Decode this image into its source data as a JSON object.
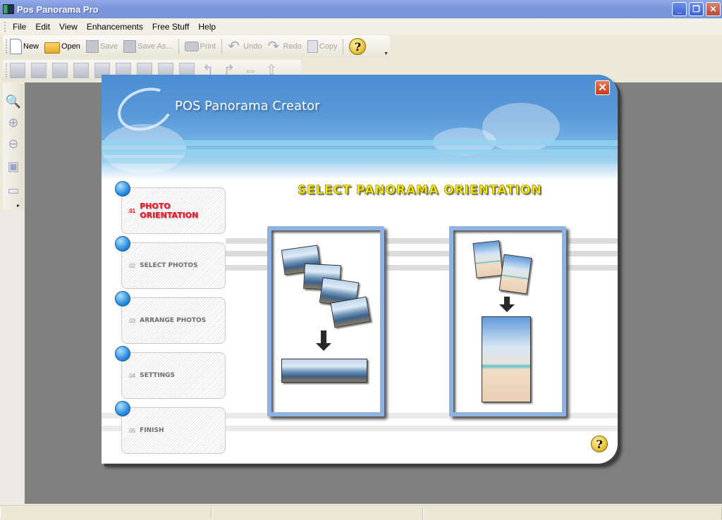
{
  "window": {
    "title": "Pos Panorama Pro",
    "controls": [
      "minimize",
      "restore",
      "close"
    ]
  },
  "menu": [
    "File",
    "Edit",
    "View",
    "Enhancements",
    "Free Stuff",
    "Help"
  ],
  "toolbar": [
    {
      "label": "New",
      "icon": "new-document-icon",
      "enabled": true
    },
    {
      "label": "Open",
      "icon": "folder-open-icon",
      "enabled": true
    },
    {
      "label": "Save",
      "icon": "save-icon",
      "enabled": false
    },
    {
      "label": "Save As...",
      "icon": "save-as-icon",
      "enabled": false
    },
    {
      "label": "Print",
      "icon": "printer-icon",
      "enabled": false
    },
    {
      "label": "Undo",
      "icon": "undo-icon",
      "enabled": false
    },
    {
      "label": "Redo",
      "icon": "redo-icon",
      "enabled": false
    },
    {
      "label": "Copy",
      "icon": "copy-icon",
      "enabled": false
    }
  ],
  "toolbar_help_icon": "?",
  "dialog": {
    "title": "POS Panorama Creator",
    "close_glyph": "✕",
    "heading": "SELECT PANORAMA ORIENTATION",
    "steps": [
      {
        "num": ".01",
        "label": "PHOTO ORIENTATION",
        "active": true
      },
      {
        "num": ".02",
        "label": "SELECT PHOTOS",
        "active": false
      },
      {
        "num": ".03",
        "label": "ARRANGE PHOTOS",
        "active": false
      },
      {
        "num": ".04",
        "label": "SETTINGS",
        "active": false
      },
      {
        "num": ".05",
        "label": "FINISH",
        "active": false
      }
    ],
    "options": [
      {
        "name": "horizontal",
        "description": "Horizontal panorama"
      },
      {
        "name": "vertical",
        "description": "Vertical panorama"
      }
    ],
    "help_glyph": "?"
  },
  "colors": {
    "titlebar": "#7d97dc",
    "workspace": "#808080",
    "active_step": "#ef1426",
    "heading": "#fff200",
    "option_frame": "#8fb3e0"
  }
}
